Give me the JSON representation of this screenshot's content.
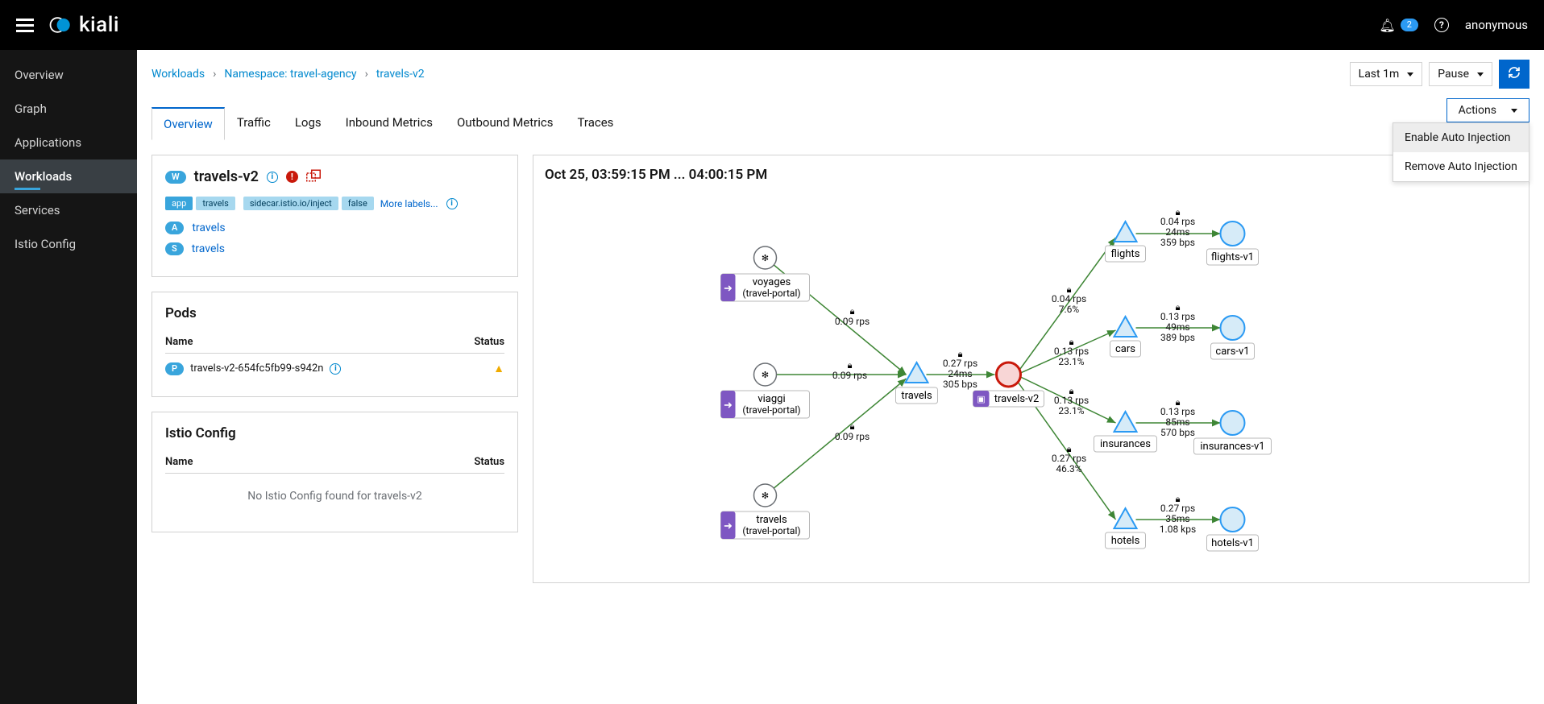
{
  "header": {
    "brand": "kiali",
    "notif_count": "2",
    "user": "anonymous"
  },
  "sidebar": {
    "items": [
      {
        "label": "Overview"
      },
      {
        "label": "Graph"
      },
      {
        "label": "Applications"
      },
      {
        "label": "Workloads"
      },
      {
        "label": "Services"
      },
      {
        "label": "Istio Config"
      }
    ]
  },
  "breadcrumb": {
    "root": "Workloads",
    "ns": "Namespace: travel-agency",
    "leaf": "travels-v2"
  },
  "toolbar": {
    "range": "Last 1m",
    "refresh_mode": "Pause",
    "actions_label": "Actions",
    "actions_menu": [
      "Enable Auto Injection",
      "Remove Auto Injection"
    ]
  },
  "tabs": [
    "Overview",
    "Traffic",
    "Logs",
    "Inbound Metrics",
    "Outbound Metrics",
    "Traces"
  ],
  "workload": {
    "name": "travels-v2",
    "labels": [
      {
        "k": "app",
        "v": "travels"
      },
      {
        "k": "sidecar.istio.io/inject",
        "v": "false"
      }
    ],
    "more_labels": "More labels...",
    "app_link": "travels",
    "svc_link": "travels"
  },
  "pods": {
    "title": "Pods",
    "colName": "Name",
    "colStatus": "Status",
    "rows": [
      {
        "name": "travels-v2-654fc5fb99-s942n"
      }
    ]
  },
  "istio": {
    "title": "Istio Config",
    "colName": "Name",
    "colStatus": "Status",
    "empty": "No Istio Config found for travels-v2"
  },
  "graph": {
    "timespan": "Oct 25, 03:59:15 PM ... 04:00:15 PM",
    "nodes": {
      "voyages_app": {
        "label": "voyages",
        "sub": "(travel-portal)"
      },
      "viaggi_app": {
        "label": "viaggi",
        "sub": "(travel-portal)"
      },
      "travels_app": {
        "label": "travels",
        "sub": "(travel-portal)"
      },
      "travels_svc": {
        "label": "travels"
      },
      "travels_v2": {
        "label": "travels-v2"
      },
      "flights_svc": {
        "label": "flights"
      },
      "flights_v1": {
        "label": "flights-v1"
      },
      "cars_svc": {
        "label": "cars"
      },
      "cars_v1": {
        "label": "cars-v1"
      },
      "insurances_svc": {
        "label": "insurances"
      },
      "insurances_v1": {
        "label": "insurances-v1"
      },
      "hotels_svc": {
        "label": "hotels"
      },
      "hotels_v1": {
        "label": "hotels-v1"
      }
    },
    "edges": {
      "voyages_travels": "0.09 rps",
      "viaggi_travels": "0.09 rps",
      "travelsapp_travels": "0.09 rps",
      "travels_v2_in": {
        "l1": "0.27 rps",
        "l2": "24ms",
        "l3": "305 bps"
      },
      "v2_flights": {
        "l1": "0.04 rps",
        "l2": "7.6%"
      },
      "flights_v1": {
        "l1": "0.04 rps",
        "l2": "24ms",
        "l3": "359 bps"
      },
      "v2_cars": {
        "l1": "0.13 rps",
        "l2": "23.1%"
      },
      "cars_v1": {
        "l1": "0.13 rps",
        "l2": "49ms",
        "l3": "389 bps"
      },
      "v2_insurances": {
        "l1": "0.13 rps",
        "l2": "23.1%"
      },
      "insurances_v1": {
        "l1": "0.13 rps",
        "l2": "85ms",
        "l3": "570 bps"
      },
      "v2_hotels": {
        "l1": "0.27 rps",
        "l2": "46.3%"
      },
      "hotels_v1": {
        "l1": "0.27 rps",
        "l2": "35ms",
        "l3": "1.08 kps"
      }
    }
  }
}
